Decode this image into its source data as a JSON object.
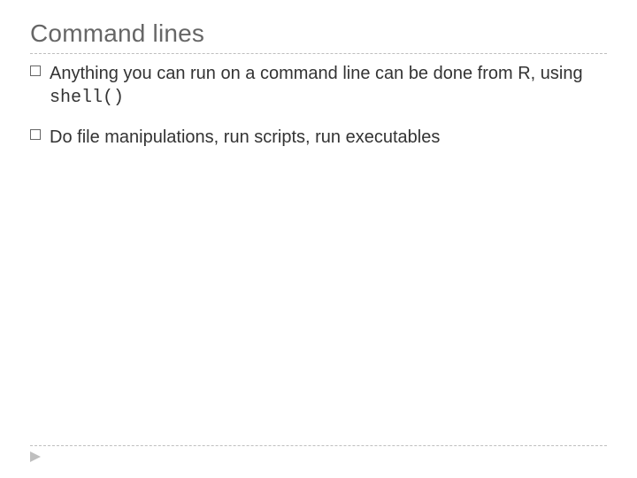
{
  "slide": {
    "title": "Command lines",
    "bullets": [
      {
        "prefix": "Anything",
        "rest_a": " you can run on a command line can be done from R, using ",
        "code": "shell()"
      },
      {
        "prefix": "Do",
        "rest_a": " file manipulations, run scripts, run executables"
      }
    ]
  }
}
